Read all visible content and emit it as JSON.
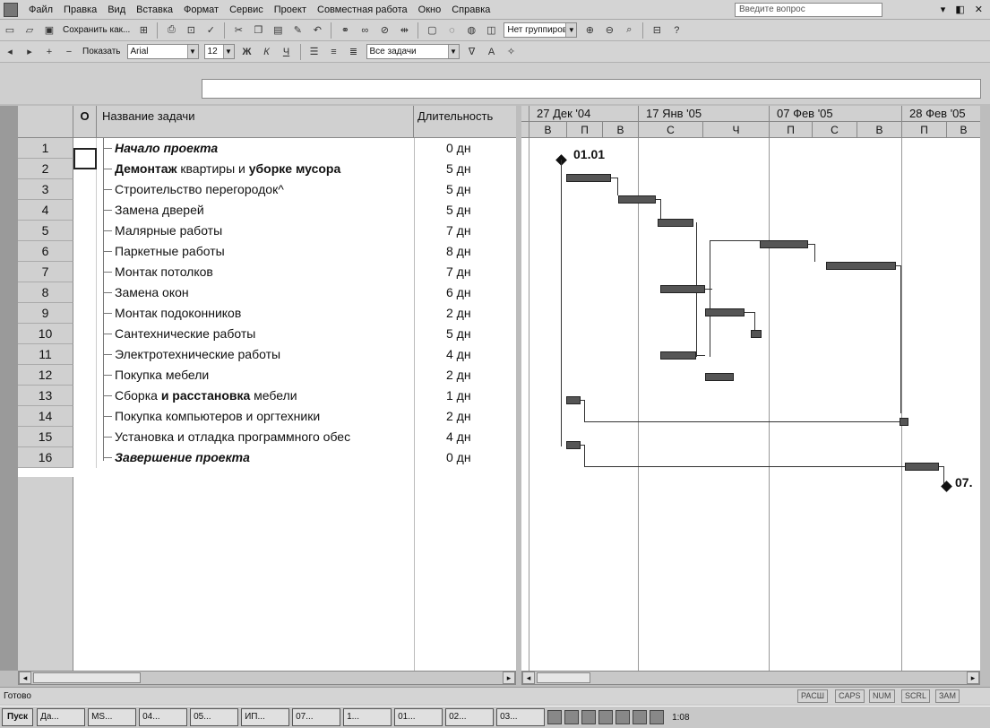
{
  "menu": [
    "Файл",
    "Правка",
    "Вид",
    "Вставка",
    "Формат",
    "Сервис",
    "Проект",
    "Совместная работа",
    "Окно",
    "Справка"
  ],
  "question_placeholder": "Введите вопрос",
  "toolbar1": {
    "save_as_label": "Сохранить как...",
    "grouping": "Нет группировки"
  },
  "toolbar2": {
    "show_label": "Показать",
    "font": "Arial",
    "font_size": "12",
    "filter": "Все задачи"
  },
  "table": {
    "indicator_header": "О",
    "name_header": "Название задачи",
    "duration_header": "Длительность",
    "rows": [
      {
        "num": "1",
        "name_parts": [
          {
            "t": "Начало проекта",
            "s": "bi"
          }
        ],
        "duration": "0 дн"
      },
      {
        "num": "2",
        "name_parts": [
          {
            "t": "Демонтаж",
            "s": "b"
          },
          {
            "t": " квартиры и ",
            "s": ""
          },
          {
            "t": "уборке мусора",
            "s": "b"
          }
        ],
        "duration": "5 дн"
      },
      {
        "num": "3",
        "name_parts": [
          {
            "t": "Строительство перегородок^",
            "s": ""
          }
        ],
        "duration": "5 дн"
      },
      {
        "num": "4",
        "name_parts": [
          {
            "t": "Замена дверей",
            "s": ""
          }
        ],
        "duration": "5 дн"
      },
      {
        "num": "5",
        "name_parts": [
          {
            "t": "Малярные работы",
            "s": ""
          }
        ],
        "duration": "7 дн"
      },
      {
        "num": "6",
        "name_parts": [
          {
            "t": "Паркетные работы",
            "s": ""
          }
        ],
        "duration": "8 дн"
      },
      {
        "num": "7",
        "name_parts": [
          {
            "t": "Монтак потолков",
            "s": ""
          }
        ],
        "duration": "7 дн"
      },
      {
        "num": "8",
        "name_parts": [
          {
            "t": "Замена окон",
            "s": ""
          }
        ],
        "duration": "6 дн"
      },
      {
        "num": "9",
        "name_parts": [
          {
            "t": "Монтак подоконников",
            "s": ""
          }
        ],
        "duration": "2 дн"
      },
      {
        "num": "10",
        "name_parts": [
          {
            "t": "Сантехнические работы",
            "s": ""
          }
        ],
        "duration": "5 дн"
      },
      {
        "num": "11",
        "name_parts": [
          {
            "t": "Электротехнические работы",
            "s": ""
          }
        ],
        "duration": "4 дн"
      },
      {
        "num": "12",
        "name_parts": [
          {
            "t": "Покупка мебели",
            "s": ""
          }
        ],
        "duration": "2 дн"
      },
      {
        "num": "13",
        "name_parts": [
          {
            "t": "Сборка ",
            "s": ""
          },
          {
            "t": "и расстановка",
            "s": "b"
          },
          {
            "t": " мебели",
            "s": ""
          }
        ],
        "duration": "1 дн"
      },
      {
        "num": "14",
        "name_parts": [
          {
            "t": "Покупка компьютеров и оргтехники",
            "s": ""
          }
        ],
        "duration": "2 дн"
      },
      {
        "num": "15",
        "name_parts": [
          {
            "t": "Установка и отладка программного обес",
            "s": ""
          }
        ],
        "duration": "4 дн"
      },
      {
        "num": "16",
        "name_parts": [
          {
            "t": "Завершение проекта",
            "s": "bi"
          }
        ],
        "duration": "0 дн"
      }
    ]
  },
  "gantt": {
    "weeks": [
      "27 Дек '04",
      "17 Янв '05",
      "07 Фев '05",
      "28 Фев '05"
    ],
    "days": [
      "В",
      "П",
      "В",
      "С",
      "Ч",
      "П",
      "С",
      "В",
      "П",
      "В"
    ],
    "start_milestone_label": "01.01",
    "end_milestone_label": "07."
  },
  "status": {
    "text": "Готово",
    "indicators": [
      "РАСШ",
      "CAPS",
      "NUM",
      "SCRL",
      "ЗАМ"
    ]
  },
  "taskbar": {
    "start": "Пуск",
    "tasks": [
      "Да...",
      "MS...",
      "04...",
      "05...",
      "ИП...",
      "07...",
      "1...",
      "01...",
      "02...",
      "03..."
    ],
    "clock": "1:08"
  }
}
